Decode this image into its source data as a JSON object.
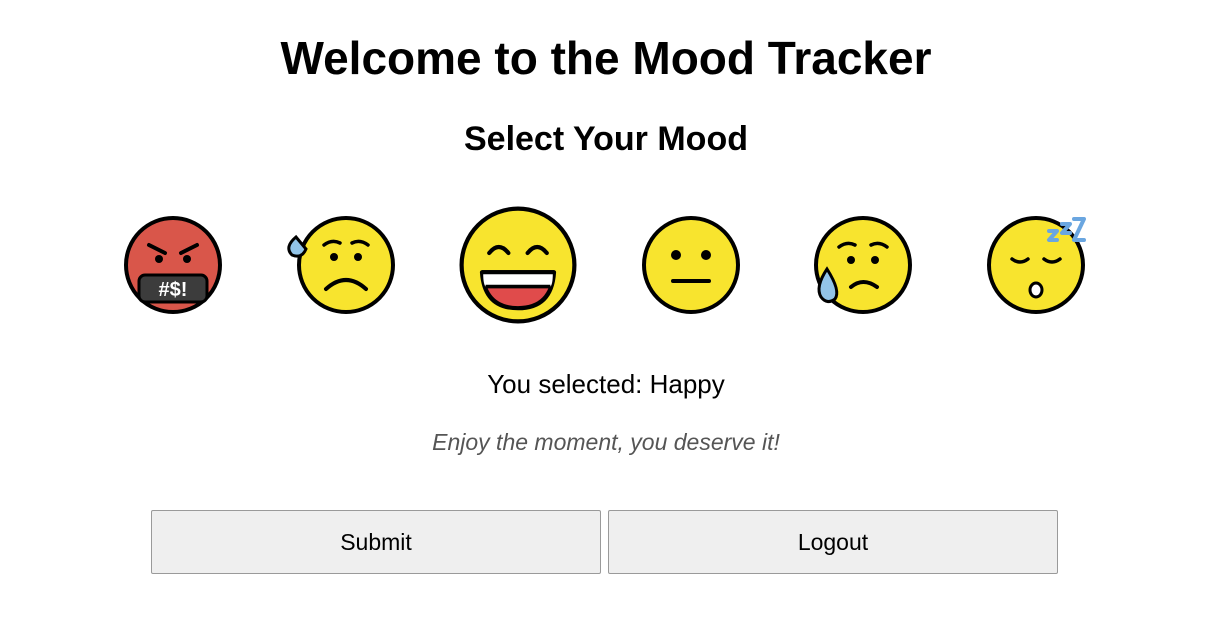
{
  "header": {
    "title": "Welcome to the Mood Tracker",
    "subtitle": "Select Your Mood"
  },
  "moods": [
    {
      "icon": "angry-cursing-face-icon",
      "symbol_text": "#$!",
      "selected": false
    },
    {
      "icon": "anxious-sweat-face-icon",
      "selected": false
    },
    {
      "icon": "grinning-face-icon",
      "selected": true
    },
    {
      "icon": "neutral-face-icon",
      "selected": false
    },
    {
      "icon": "sad-tear-face-icon",
      "selected": false
    },
    {
      "icon": "sleeping-face-icon",
      "selected": false
    }
  ],
  "selection": {
    "text": "You selected: Happy"
  },
  "message": {
    "text": "Enjoy the moment, you deserve it!"
  },
  "buttons": {
    "submit_label": "Submit",
    "logout_label": "Logout"
  },
  "colors": {
    "face_yellow": "#f8e42e",
    "angry_red": "#d9564a",
    "outline": "#000000",
    "tear_blue": "#92c4e8",
    "zzz_blue": "#6aa6e0",
    "button_bg": "#efefef",
    "message_text": "#555555"
  }
}
